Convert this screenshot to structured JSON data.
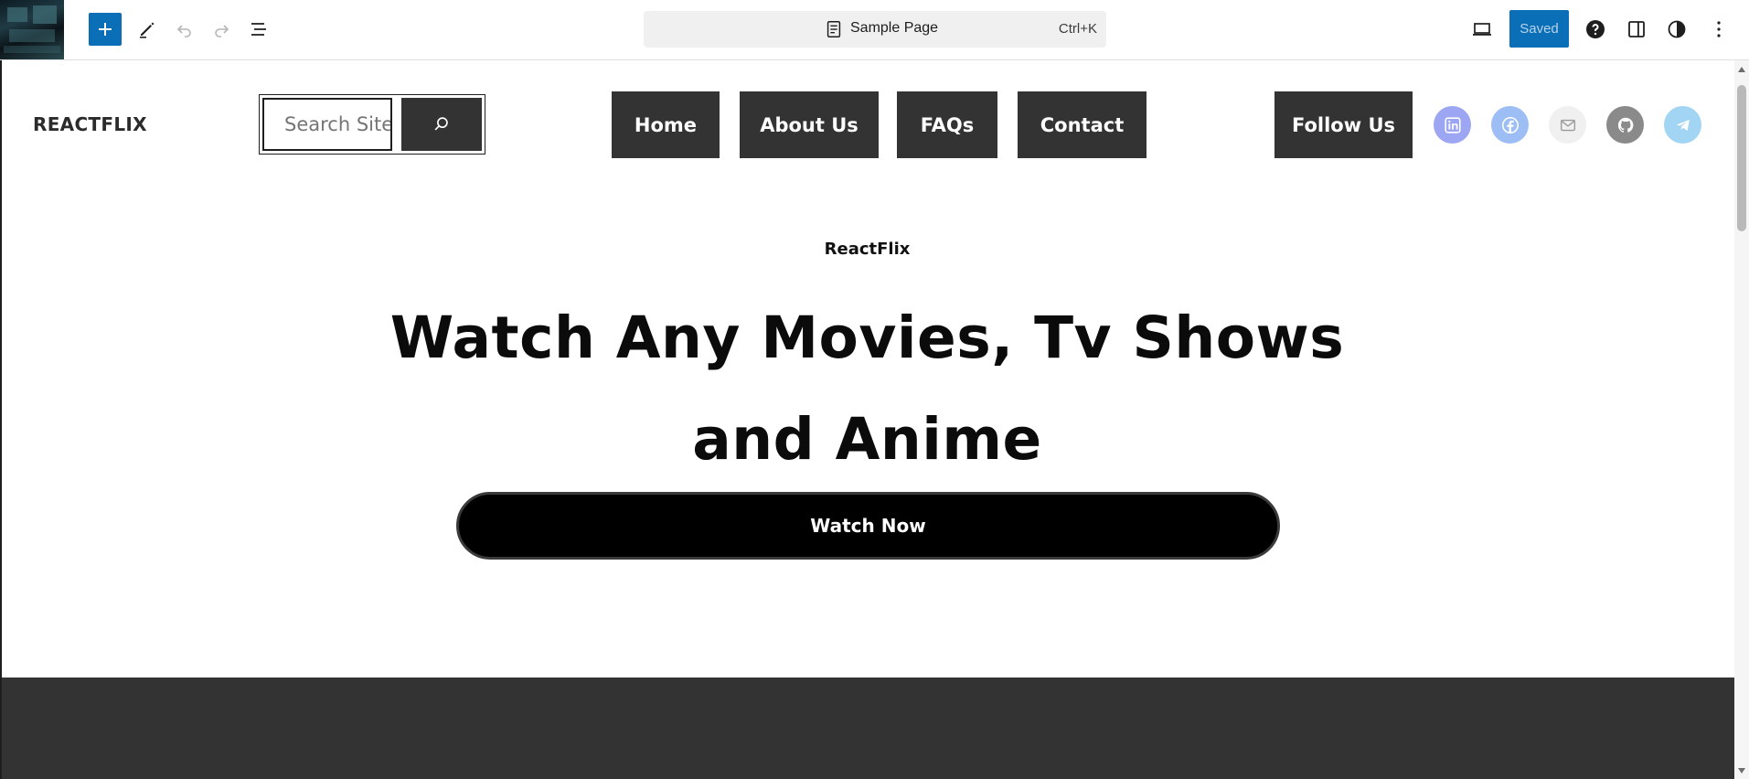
{
  "toolbar": {
    "document_title": "Sample Page",
    "shortcut": "Ctrl+K",
    "saved_label": "Saved",
    "accent_color": "#0a6fb6"
  },
  "site": {
    "logo_text": "REACTFLIX",
    "search_placeholder": "Search Site",
    "nav_items": [
      "Home",
      "About Us",
      "FAQs",
      "Contact"
    ],
    "follow_label": "Follow Us",
    "social_icons": [
      "linkedin-icon",
      "facebook-icon",
      "mail-icon",
      "github-icon",
      "telegram-icon"
    ],
    "nav_bg_color": "#333333"
  },
  "hero": {
    "eyebrow": "ReactFlix",
    "title": "Watch Any Movies, Tv Shows and Anime",
    "button_label": "Watch Now"
  }
}
